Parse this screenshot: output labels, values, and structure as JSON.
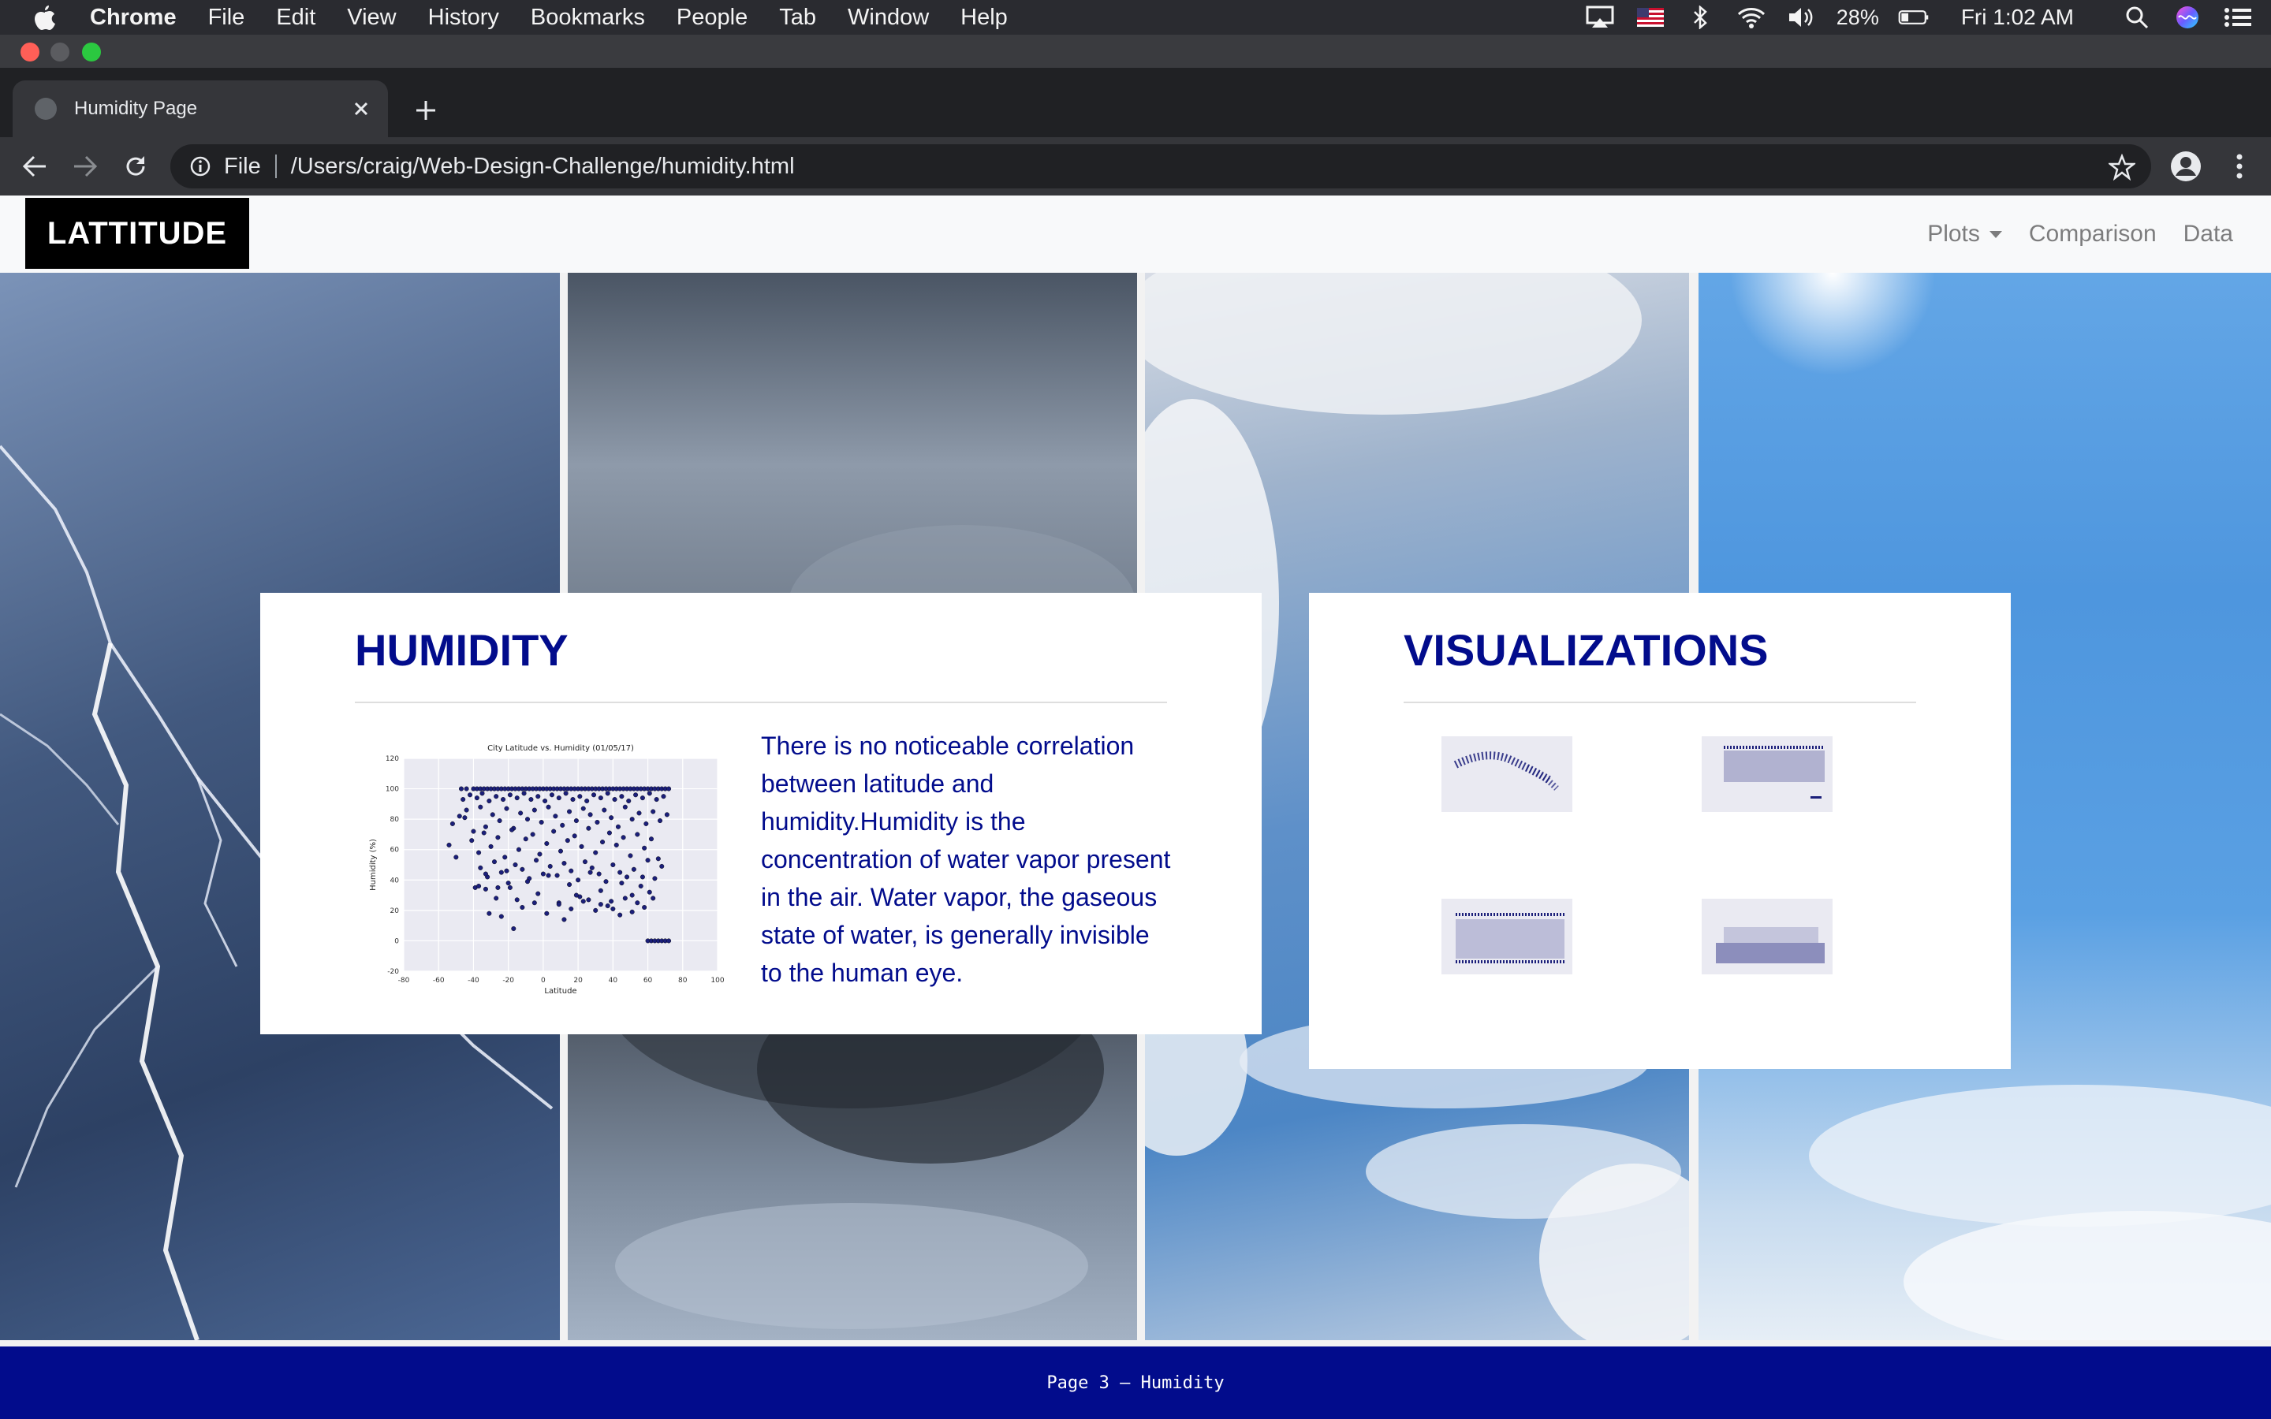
{
  "menubar": {
    "app_name": "Chrome",
    "menus": [
      "File",
      "Edit",
      "View",
      "History",
      "Bookmarks",
      "People",
      "Tab",
      "Window",
      "Help"
    ],
    "battery": "28%",
    "clock": "Fri 1:02 AM"
  },
  "browser": {
    "tab_title": "Humidity Page",
    "address_scheme": "File",
    "address_path": "/Users/craig/Web-Design-Challenge/humidity.html"
  },
  "navbar": {
    "brand": "LATTITUDE",
    "links": [
      "Plots",
      "Comparison",
      "Data"
    ]
  },
  "humidity_card": {
    "title": "HUMIDITY",
    "description": "There is no noticeable correlation between latitude and humidity.Humidity is the concentration of water vapor present in the air. Water vapor, the gaseous state of water, is generally invisible to the human eye."
  },
  "visualizations_card": {
    "title": "VISUALIZATIONS"
  },
  "footer": {
    "text": "Page 3 – Humidity"
  },
  "colors": {
    "heading": "#020c8c",
    "footer": "#020c8c",
    "points": "#1b1f7a"
  },
  "chart_data": {
    "type": "scatter",
    "title": "City Latitude vs. Humidity (01/05/17)",
    "xlabel": "Latitude",
    "ylabel": "Humidity (%)",
    "xlim": [
      -80,
      100
    ],
    "ylim": [
      -20,
      120
    ],
    "xticks": [
      "-80",
      "-60",
      "-40",
      "-20",
      "0",
      "20",
      "40",
      "60",
      "80",
      "100"
    ],
    "yticks": [
      "-20",
      "0",
      "20",
      "40",
      "60",
      "80",
      "100",
      "120"
    ],
    "grid": true,
    "series": [
      {
        "x": [
          -47,
          -44,
          -40,
          -38,
          -36,
          -34,
          -32,
          -30,
          -28,
          -26,
          -24,
          -22,
          -20,
          -18,
          -16,
          -14,
          -12,
          -10,
          -8,
          -6,
          -4,
          -2,
          0,
          2,
          4,
          6,
          8,
          10,
          12,
          14,
          16,
          18,
          20,
          22,
          24,
          26,
          28,
          30,
          32,
          34,
          36,
          38,
          40,
          42,
          44,
          46,
          48,
          50,
          52,
          54,
          56,
          58,
          60,
          62,
          64,
          66,
          68,
          70,
          72,
          -46,
          -42,
          -38,
          -35,
          -31,
          -27,
          -23,
          -19,
          -15,
          -11,
          -7,
          -3,
          1,
          5,
          9,
          13,
          17,
          21,
          25,
          29,
          33,
          37,
          41,
          45,
          49,
          53,
          57,
          61,
          65,
          69,
          -52,
          -48,
          -44,
          -40,
          -36,
          -33,
          -29,
          -25,
          -21,
          -17,
          -13,
          -9,
          -5,
          -1,
          3,
          7,
          11,
          15,
          19,
          23,
          27,
          31,
          35,
          39,
          43,
          47,
          51,
          55,
          59,
          63,
          67,
          71,
          -41,
          -37,
          -34,
          -30,
          -26,
          -22,
          -18,
          -14,
          -10,
          -6,
          -2,
          2,
          6,
          10,
          14,
          18,
          22,
          26,
          30,
          34,
          38,
          42,
          46,
          50,
          54,
          58,
          62,
          66,
          -36,
          -32,
          -28,
          -24,
          -20,
          -16,
          -12,
          -8,
          -4,
          0,
          4,
          8,
          12,
          16,
          20,
          24,
          28,
          32,
          36,
          40,
          44,
          48,
          52,
          56,
          60,
          64,
          68,
          -54,
          -50,
          -45,
          -39,
          -33,
          -27,
          -21,
          -15,
          -9,
          -3,
          3,
          9,
          15,
          21,
          27,
          33,
          39,
          45,
          51,
          57,
          63,
          -37,
          -33,
          -26,
          -19,
          -12,
          -5,
          2,
          9,
          16,
          23,
          30,
          37,
          44,
          51,
          58,
          -31,
          -24,
          -17,
          12,
          19,
          26,
          33,
          40,
          47,
          54,
          61,
          60,
          62,
          64,
          66,
          68,
          70,
          72
        ],
        "y": [
          100,
          100,
          100,
          100,
          100,
          100,
          100,
          100,
          100,
          100,
          100,
          100,
          100,
          100,
          100,
          100,
          100,
          100,
          100,
          100,
          100,
          100,
          100,
          100,
          100,
          100,
          100,
          100,
          100,
          100,
          100,
          100,
          100,
          100,
          100,
          100,
          100,
          100,
          100,
          100,
          100,
          100,
          100,
          100,
          100,
          100,
          100,
          100,
          100,
          100,
          100,
          100,
          100,
          100,
          100,
          100,
          100,
          100,
          100,
          93,
          96,
          94,
          97,
          92,
          95,
          93,
          96,
          94,
          97,
          93,
          95,
          92,
          96,
          94,
          97,
          93,
          95,
          92,
          96,
          94,
          97,
          93,
          95,
          92,
          96,
          94,
          97,
          93,
          95,
          77,
          82,
          86,
          72,
          88,
          75,
          83,
          79,
          87,
          74,
          84,
          80,
          86,
          78,
          88,
          82,
          76,
          85,
          79,
          87,
          83,
          78,
          86,
          81,
          75,
          88,
          80,
          84,
          77,
          85,
          79,
          83,
          66,
          58,
          71,
          62,
          68,
          55,
          73,
          60,
          67,
          70,
          57,
          64,
          72,
          59,
          66,
          69,
          62,
          74,
          58,
          65,
          71,
          63,
          68,
          56,
          70,
          61,
          67,
          54,
          48,
          42,
          52,
          45,
          38,
          50,
          47,
          41,
          53,
          44,
          49,
          43,
          51,
          46,
          40,
          52,
          48,
          44,
          39,
          50,
          45,
          42,
          47,
          36,
          53,
          41,
          49,
          63,
          55,
          81,
          35,
          44,
          28,
          46,
          27,
          39,
          31,
          43,
          25,
          37,
          29,
          45,
          33,
          26,
          38,
          30,
          42,
          28,
          36,
          34,
          35,
          35,
          22,
          25,
          18,
          24,
          21,
          26,
          20,
          23,
          17,
          19,
          22,
          18,
          16,
          8,
          14,
          30,
          27,
          24,
          21,
          28,
          25,
          32,
          0,
          0,
          0,
          0,
          0,
          0,
          0
        ]
      }
    ]
  }
}
